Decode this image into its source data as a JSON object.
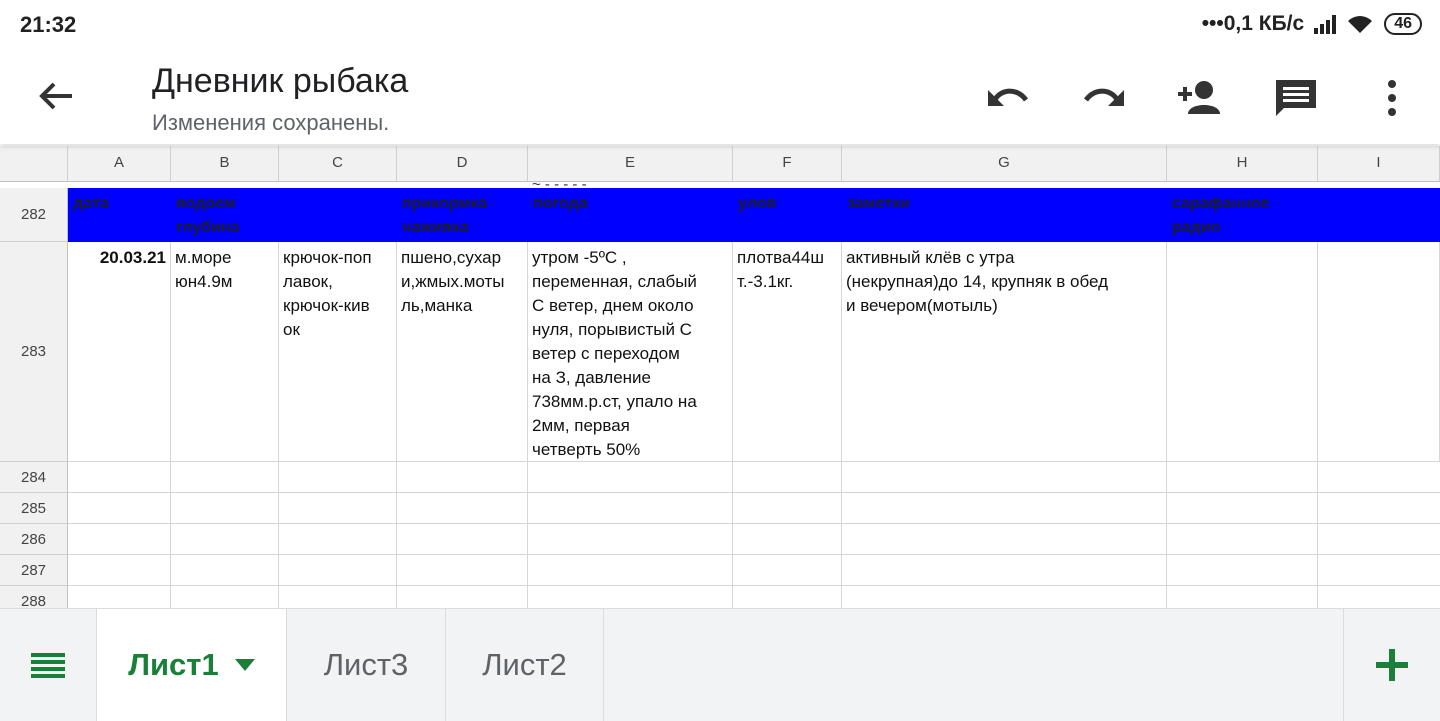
{
  "status": {
    "time": "21:32",
    "net": "•••0,1 КБ/с",
    "battery": "46"
  },
  "appbar": {
    "title": "Дневник рыбака",
    "subtitle": "Изменения сохранены."
  },
  "columns": [
    "A",
    "B",
    "C",
    "D",
    "E",
    "F",
    "G",
    "H",
    "I"
  ],
  "partial_text": "~ - - - - -",
  "rows": [
    "282",
    "283",
    "284",
    "285",
    "286",
    "287",
    "288"
  ],
  "header_row": {
    "a": "дата",
    "b": "водоем\nглубина",
    "d": "прикормка\nнаживка",
    "e": "погода",
    "f": "улов",
    "g": "заметки",
    "h": "сарафанное\nрадио"
  },
  "entry": {
    "a": "20.03.21",
    "b": "м.море\nюн4.9м",
    "c": "крючок-поп\nлавок,\nкрючок-кив\nок",
    "d": "пшено,сухар\nи,жмых.моты\nль,манка",
    "e": "утром -5ºС ,\nпеременная,  слабый\nС ветер, днем около\nнуля, порывистый С\nветер с переходом\nна З,  давление\n738мм.р.ст, упало на\n2мм, первая\nчетверть 50%",
    "f": "плотва44ш\nт.-3.1кг.",
    "g": "активный клёв с утра\n(некрупная)до 14, крупняк в обед\nи вечером(мотыль)",
    "h": ""
  },
  "tabs": [
    "Лист1",
    "Лист3",
    "Лист2"
  ],
  "colors": {
    "header_blue": "#0000ff",
    "accent_green": "#188038"
  }
}
